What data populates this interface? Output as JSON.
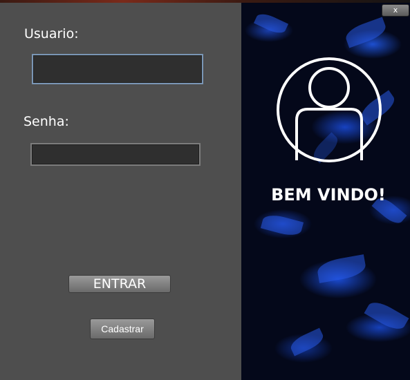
{
  "login": {
    "username_label": "Usuario:",
    "username_value": "",
    "password_label": "Senha:",
    "password_value": "",
    "enter_label": "ENTRAR",
    "register_label": "Cadastrar"
  },
  "window": {
    "close_label": "x"
  },
  "welcome": {
    "text": "BEM VINDO!",
    "icon": "user-avatar-icon"
  },
  "colors": {
    "panel": "#4e4e4e",
    "field": "#2f2f2f",
    "focus_border": "#7a96b5",
    "background_accent": "#1d4fd0"
  }
}
